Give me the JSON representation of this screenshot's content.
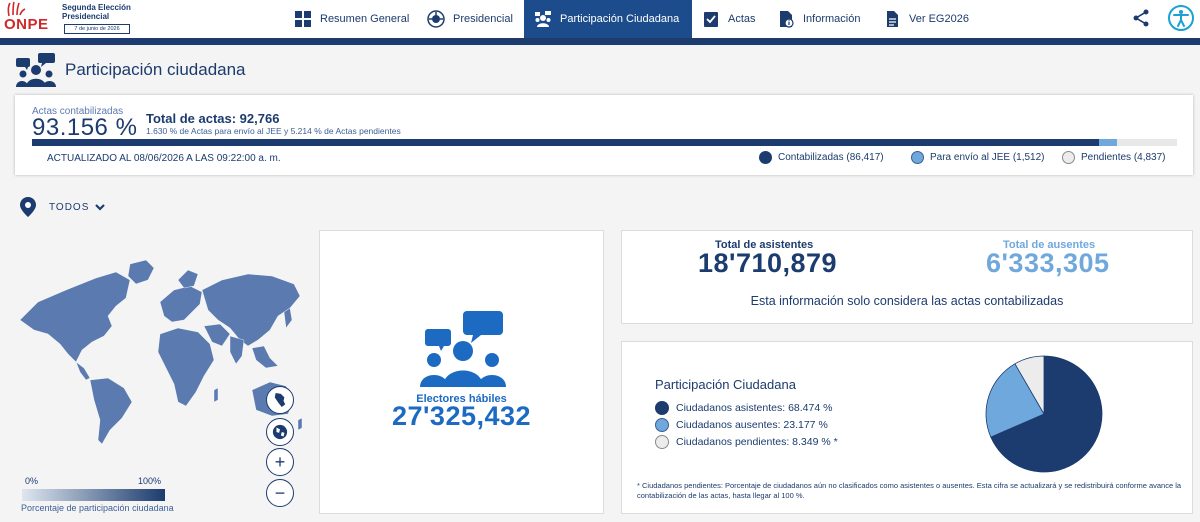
{
  "header": {
    "logo_text": "ONPE",
    "election_line1": "Segunda Elección",
    "election_line2": "Presidencial",
    "election_date": "7 de junio de 2026",
    "nav": [
      {
        "label": "Resumen General",
        "icon": "grid-icon",
        "active": false
      },
      {
        "label": "Presidencial",
        "icon": "seal-icon",
        "active": false
      },
      {
        "label": "Participación Ciudadana",
        "icon": "people-icon",
        "active": true
      },
      {
        "label": "Actas",
        "icon": "checklist-icon",
        "active": false
      },
      {
        "label": "Información",
        "icon": "info-doc-icon",
        "active": false
      },
      {
        "label": "Ver EG2026",
        "icon": "document-icon",
        "active": false
      }
    ]
  },
  "page": {
    "title": "Participación ciudadana"
  },
  "progress": {
    "label": "Actas contabilizadas",
    "percent": "93.156 %",
    "total": "Total de actas: 92,766",
    "subtitle": "1.630 % de Actas para envío al JEE y 5.214 % de Actas pendientes",
    "updated": "ACTUALIZADO AL 08/06/2026 A LAS 09:22:00 a. m.",
    "fractions": {
      "contabilizadas": 0.93156,
      "jee": 0.0163,
      "pendientes": 0.05214
    },
    "legend": [
      {
        "label": "Contabilizadas (86,417)",
        "color": "#1c3b6e"
      },
      {
        "label": "Para envío al JEE (1,512)",
        "color": "#6fa8dc"
      },
      {
        "label": "Pendientes (4,837)",
        "color": "#ececec"
      }
    ]
  },
  "filter": {
    "location": "TODOS"
  },
  "map": {
    "scale_min": "0%",
    "scale_max": "100%",
    "scale_label": "Porcentaje de participación ciudadana",
    "controls": [
      "peru-icon",
      "globe-icon",
      "zoom-in-icon",
      "zoom-out-icon"
    ]
  },
  "electores": {
    "label": "Electores hábiles",
    "value": "27'325,432"
  },
  "asistencia": {
    "asistentes_label": "Total de asistentes",
    "asistentes_value": "18'710,879",
    "ausentes_label": "Total de ausentes",
    "ausentes_value": "6'333,305",
    "note": "Esta información solo considera las actas contabilizadas"
  },
  "participacion": {
    "title": "Participación Ciudadana",
    "items": [
      {
        "label": "Ciudadanos asistentes: 68.474 %",
        "color": "#1c3b6e"
      },
      {
        "label": "Ciudadanos ausentes: 23.177 %",
        "color": "#6fa8dc"
      },
      {
        "label": "Ciudadanos pendientes: 8.349 % *",
        "color": "#ececec"
      }
    ],
    "footnote": "* Ciudadanos pendientes: Porcentaje de ciudadanos aún no clasificados como asistentes o ausentes. Esta cifra se actualizará y se redistribuirá conforme avance la contabilización de las actas, hasta llegar al 100 %.",
    "pie": [
      {
        "value": 68.474,
        "color": "#1c3b6e"
      },
      {
        "value": 23.177,
        "color": "#6fa8dc"
      },
      {
        "value": 8.349,
        "color": "#ececec"
      }
    ]
  }
}
